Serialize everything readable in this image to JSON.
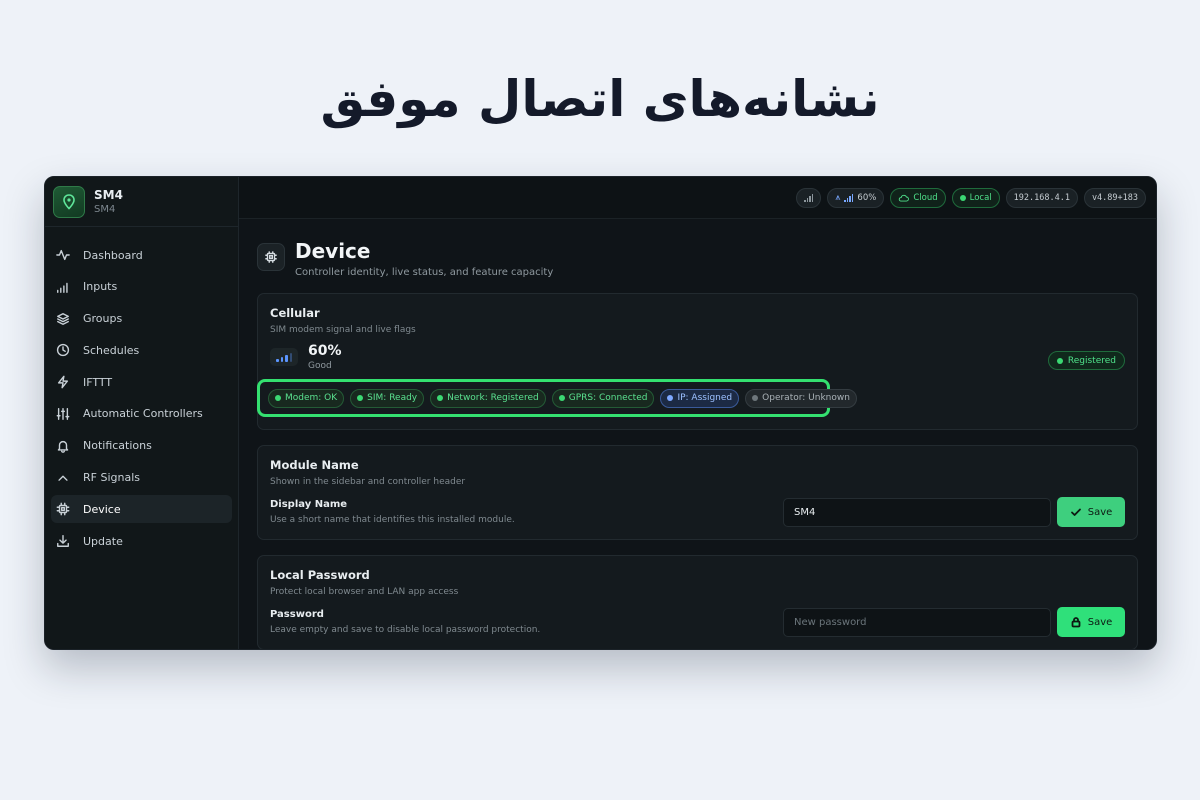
{
  "heading": "نشانه‌های اتصال موفق",
  "brand": {
    "name": "SM4",
    "sub": "SM4"
  },
  "sidebar": {
    "items": [
      {
        "label": "Dashboard",
        "icon": "activity-icon"
      },
      {
        "label": "Inputs",
        "icon": "signal-bars-icon"
      },
      {
        "label": "Groups",
        "icon": "layers-icon"
      },
      {
        "label": "Schedules",
        "icon": "clock-icon"
      },
      {
        "label": "IFTTT",
        "icon": "bolt-icon"
      },
      {
        "label": "Automatic Controllers",
        "icon": "sliders-icon"
      },
      {
        "label": "Notifications",
        "icon": "bell-icon"
      },
      {
        "label": "RF Signals",
        "icon": "chevron-up-icon"
      },
      {
        "label": "Device",
        "icon": "chip-icon",
        "active": true
      },
      {
        "label": "Update",
        "icon": "download-icon"
      }
    ]
  },
  "topbar": {
    "signal_pct": "60%",
    "cloud": "Cloud",
    "local": "Local",
    "ip": "192.168.4.1",
    "version": "v4.89+183"
  },
  "page": {
    "title": "Device",
    "subtitle": "Controller identity, live status, and feature capacity"
  },
  "cellular": {
    "title": "Cellular",
    "desc": "SIM modem signal and live flags",
    "signal_pct": "60%",
    "quality": "Good",
    "registered": "Registered",
    "flags": [
      {
        "label": "Modem: OK",
        "style": "green"
      },
      {
        "label": "SIM: Ready",
        "style": "green"
      },
      {
        "label": "Network: Registered",
        "style": "green"
      },
      {
        "label": "GPRS: Connected",
        "style": "green"
      },
      {
        "label": "IP: Assigned",
        "style": "blue"
      },
      {
        "label": "Operator: Unknown",
        "style": "gray"
      }
    ]
  },
  "module_name": {
    "title": "Module Name",
    "desc": "Shown in the sidebar and controller header",
    "field_label": "Display Name",
    "field_help": "Use a short name that identifies this installed module.",
    "value": "SM4",
    "save_label": "Save"
  },
  "local_password": {
    "title": "Local Password",
    "desc": "Protect local browser and LAN app access",
    "field_label": "Password",
    "field_help": "Leave empty and save to disable local password protection.",
    "placeholder": "New password",
    "save_label": "Save"
  },
  "colors": {
    "accent_green": "#3ecf7e",
    "highlight_border": "#34e070",
    "info_blue": "#7ea8ff"
  }
}
